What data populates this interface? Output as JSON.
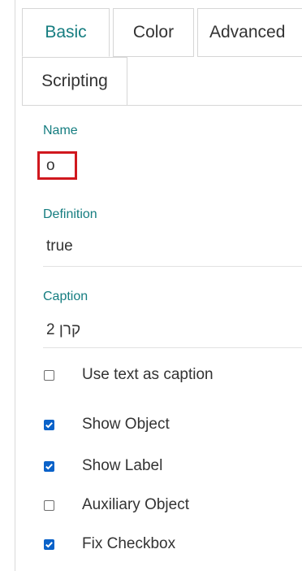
{
  "tabs": {
    "basic": "Basic",
    "color": "Color",
    "advanced": "Advanced",
    "scripting": "Scripting"
  },
  "fields": {
    "name_label": "Name",
    "name_value": "o",
    "definition_label": "Definition",
    "definition_value": "true",
    "caption_label": "Caption",
    "caption_value": "קרן 2"
  },
  "checkboxes": {
    "use_text_as_caption": {
      "label": "Use text as caption",
      "checked": false
    },
    "show_object": {
      "label": "Show Object",
      "checked": true
    },
    "show_label": {
      "label": "Show Label",
      "checked": true
    },
    "auxiliary_object": {
      "label": "Auxiliary Object",
      "checked": false
    },
    "fix_checkbox": {
      "label": "Fix Checkbox",
      "checked": true
    }
  },
  "colors": {
    "accent": "#157d80",
    "checkbox_on": "#0a62c9",
    "highlight_box": "#d0181e"
  },
  "icons": {
    "check": "check-icon"
  }
}
